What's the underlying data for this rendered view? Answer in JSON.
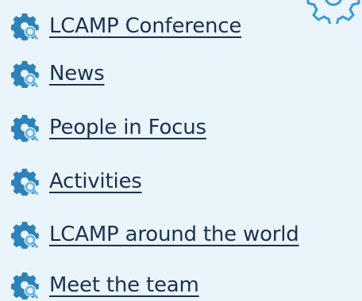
{
  "nav": {
    "items": [
      {
        "label": "LCAMP Conference",
        "icon": "gear-magnifier-icon"
      },
      {
        "label": "News",
        "icon": "gear-magnifier-icon"
      },
      {
        "label": "People in Focus",
        "icon": "gear-magnifier-icon"
      },
      {
        "label": "Activities",
        "icon": "gear-magnifier-icon"
      },
      {
        "label": "LCAMP around the world",
        "icon": "gear-magnifier-icon"
      },
      {
        "label": "Meet the team",
        "icon": "gear-magnifier-icon"
      }
    ]
  },
  "colors": {
    "background": "#e9f4fb",
    "link_text": "#1b3150",
    "gear": "#2d82b9",
    "magnifier": "#69b4e2",
    "outline": "#3b9ad6"
  }
}
